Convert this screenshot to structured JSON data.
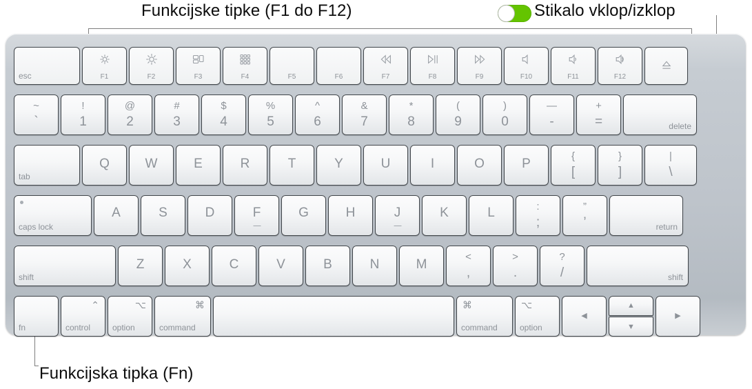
{
  "captions": {
    "function_keys": "Funkcijske tipke (F1 do F12)",
    "power_toggle": "Stikalo vklop/izklop",
    "fn_key": "Funkcijska tipka (Fn)"
  },
  "colors": {
    "toggle_on": "#64c400",
    "toggle_knob": "#ffffff",
    "key_face": "#f7f8f9",
    "key_border": "#3f4449",
    "legend": "#8d9298",
    "chassis": "#c6ccd2",
    "leader_line": "#7e7e7e",
    "caption_text": "#0d0d0d"
  },
  "keyboard": {
    "function_row": [
      {
        "name": "esc",
        "label": "esc",
        "icon": null
      },
      {
        "name": "f1",
        "label": "F1",
        "icon": "brightness-down-icon"
      },
      {
        "name": "f2",
        "label": "F2",
        "icon": "brightness-up-icon"
      },
      {
        "name": "f3",
        "label": "F3",
        "icon": "mission-control-icon"
      },
      {
        "name": "f4",
        "label": "F4",
        "icon": "launchpad-icon"
      },
      {
        "name": "f5",
        "label": "F5",
        "icon": null
      },
      {
        "name": "f6",
        "label": "F6",
        "icon": null
      },
      {
        "name": "f7",
        "label": "F7",
        "icon": "rewind-icon"
      },
      {
        "name": "f8",
        "label": "F8",
        "icon": "play-pause-icon"
      },
      {
        "name": "f9",
        "label": "F9",
        "icon": "fast-forward-icon"
      },
      {
        "name": "f10",
        "label": "F10",
        "icon": "mute-icon"
      },
      {
        "name": "f11",
        "label": "F11",
        "icon": "volume-down-icon"
      },
      {
        "name": "f12",
        "label": "F12",
        "icon": "volume-up-icon"
      },
      {
        "name": "eject",
        "label": "",
        "icon": "eject-icon"
      }
    ],
    "number_row": [
      {
        "name": "grave",
        "upper": "~",
        "lower": "`"
      },
      {
        "name": "one",
        "upper": "!",
        "lower": "1"
      },
      {
        "name": "two",
        "upper": "@",
        "lower": "2"
      },
      {
        "name": "three",
        "upper": "#",
        "lower": "3"
      },
      {
        "name": "four",
        "upper": "$",
        "lower": "4"
      },
      {
        "name": "five",
        "upper": "%",
        "lower": "5"
      },
      {
        "name": "six",
        "upper": "^",
        "lower": "6"
      },
      {
        "name": "seven",
        "upper": "&",
        "lower": "7"
      },
      {
        "name": "eight",
        "upper": "*",
        "lower": "8"
      },
      {
        "name": "nine",
        "upper": "(",
        "lower": "9"
      },
      {
        "name": "zero",
        "upper": ")",
        "lower": "0"
      },
      {
        "name": "minus",
        "upper": "—",
        "lower": "-"
      },
      {
        "name": "equal",
        "upper": "+",
        "lower": "="
      },
      {
        "name": "delete",
        "word": "delete"
      }
    ],
    "top_letter_row": [
      {
        "name": "tab",
        "word": "tab"
      },
      {
        "name": "q",
        "letter": "Q"
      },
      {
        "name": "w",
        "letter": "W"
      },
      {
        "name": "e",
        "letter": "E"
      },
      {
        "name": "r",
        "letter": "R"
      },
      {
        "name": "t",
        "letter": "T"
      },
      {
        "name": "y",
        "letter": "Y"
      },
      {
        "name": "u",
        "letter": "U"
      },
      {
        "name": "i",
        "letter": "I"
      },
      {
        "name": "o",
        "letter": "O"
      },
      {
        "name": "p",
        "letter": "P"
      },
      {
        "name": "bracket-left",
        "upper": "{",
        "lower": "["
      },
      {
        "name": "bracket-right",
        "upper": "}",
        "lower": "]"
      },
      {
        "name": "backslash",
        "upper": "|",
        "lower": "\\"
      }
    ],
    "home_row": [
      {
        "name": "caps-lock",
        "word": "caps lock",
        "led": true
      },
      {
        "name": "a",
        "letter": "A"
      },
      {
        "name": "s",
        "letter": "S"
      },
      {
        "name": "d",
        "letter": "D"
      },
      {
        "name": "f",
        "letter": "F",
        "homing": true
      },
      {
        "name": "g",
        "letter": "G"
      },
      {
        "name": "h",
        "letter": "H"
      },
      {
        "name": "j",
        "letter": "J",
        "homing": true
      },
      {
        "name": "k",
        "letter": "K"
      },
      {
        "name": "l",
        "letter": "L"
      },
      {
        "name": "semicolon",
        "upper": ":",
        "lower": ";"
      },
      {
        "name": "quote",
        "upper": "”",
        "lower": "’"
      },
      {
        "name": "return",
        "word": "return"
      }
    ],
    "shift_row": [
      {
        "name": "shift-left",
        "word": "shift"
      },
      {
        "name": "z",
        "letter": "Z"
      },
      {
        "name": "x",
        "letter": "X"
      },
      {
        "name": "c",
        "letter": "C"
      },
      {
        "name": "v",
        "letter": "V"
      },
      {
        "name": "b",
        "letter": "B"
      },
      {
        "name": "n",
        "letter": "N"
      },
      {
        "name": "m",
        "letter": "M"
      },
      {
        "name": "comma",
        "upper": "<",
        "lower": ","
      },
      {
        "name": "period",
        "upper": ">",
        "lower": "."
      },
      {
        "name": "slash",
        "upper": "?",
        "lower": "/"
      },
      {
        "name": "shift-right",
        "word": "shift"
      }
    ],
    "bottom_row": [
      {
        "name": "fn",
        "word": "fn",
        "symbol": null
      },
      {
        "name": "control",
        "word": "control",
        "symbol": "⌃"
      },
      {
        "name": "option-left",
        "word": "option",
        "symbol": "⌥"
      },
      {
        "name": "command-left",
        "word": "command",
        "symbol": "⌘"
      },
      {
        "name": "space",
        "word": ""
      },
      {
        "name": "command-right",
        "word": "command",
        "symbol": "⌘"
      },
      {
        "name": "option-right",
        "word": "option",
        "symbol": "⌥"
      },
      {
        "name": "arrow-left",
        "glyph": "◀"
      },
      {
        "name": "arrow-up",
        "glyph": "▲"
      },
      {
        "name": "arrow-down",
        "glyph": "▼"
      },
      {
        "name": "arrow-right",
        "glyph": "▶"
      }
    ]
  }
}
